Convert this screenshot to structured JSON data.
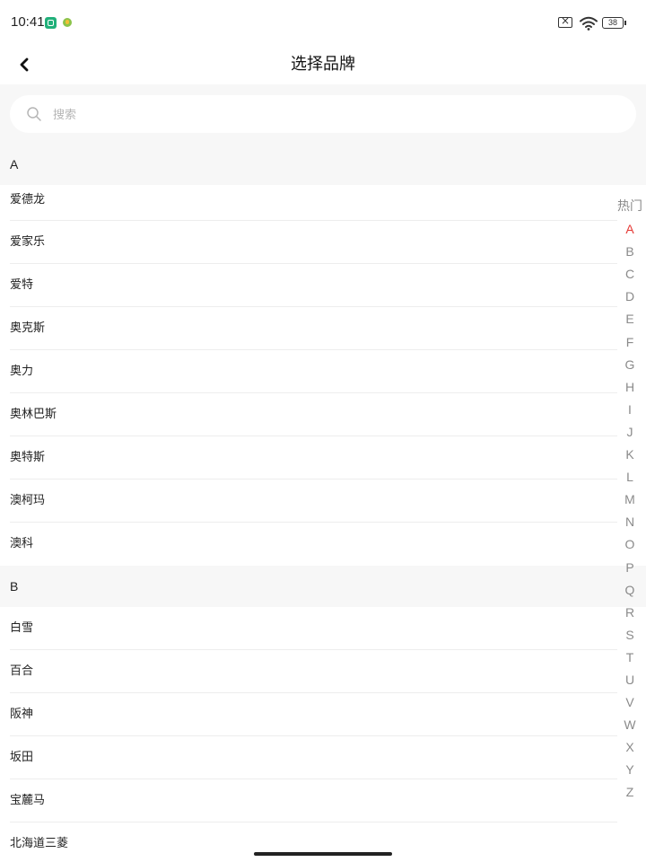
{
  "status_bar": {
    "time": "10:41",
    "battery": "38",
    "icons": [
      "app-shield-icon",
      "app-badge-icon",
      "sim-off-icon",
      "wifi-icon",
      "battery-icon"
    ]
  },
  "header": {
    "title": "选择品牌",
    "back_icon": "chevron-left-icon"
  },
  "search": {
    "placeholder": "搜索",
    "value": "",
    "icon": "search-icon"
  },
  "sections": [
    {
      "letter": "A",
      "items": [
        "爱德龙",
        "爱家乐",
        "爱特",
        "奥克斯",
        "奥力",
        "奥林巴斯",
        "奥特斯",
        "澳柯玛",
        "澳科"
      ]
    },
    {
      "letter": "B",
      "items": [
        "白雪",
        "百合",
        "阪神",
        "坂田",
        "宝麓马",
        "北海道三菱"
      ]
    }
  ],
  "index_bar": {
    "items": [
      "热门",
      "A",
      "B",
      "C",
      "D",
      "E",
      "F",
      "G",
      "H",
      "I",
      "J",
      "K",
      "L",
      "M",
      "N",
      "O",
      "P",
      "Q",
      "R",
      "S",
      "T",
      "U",
      "V",
      "W",
      "X",
      "Y",
      "Z"
    ],
    "active": "A"
  },
  "colors": {
    "accent": "#e53935",
    "section_bg": "#f7f7f7",
    "divider": "#ededed",
    "index_text": "#8a8a8a"
  }
}
